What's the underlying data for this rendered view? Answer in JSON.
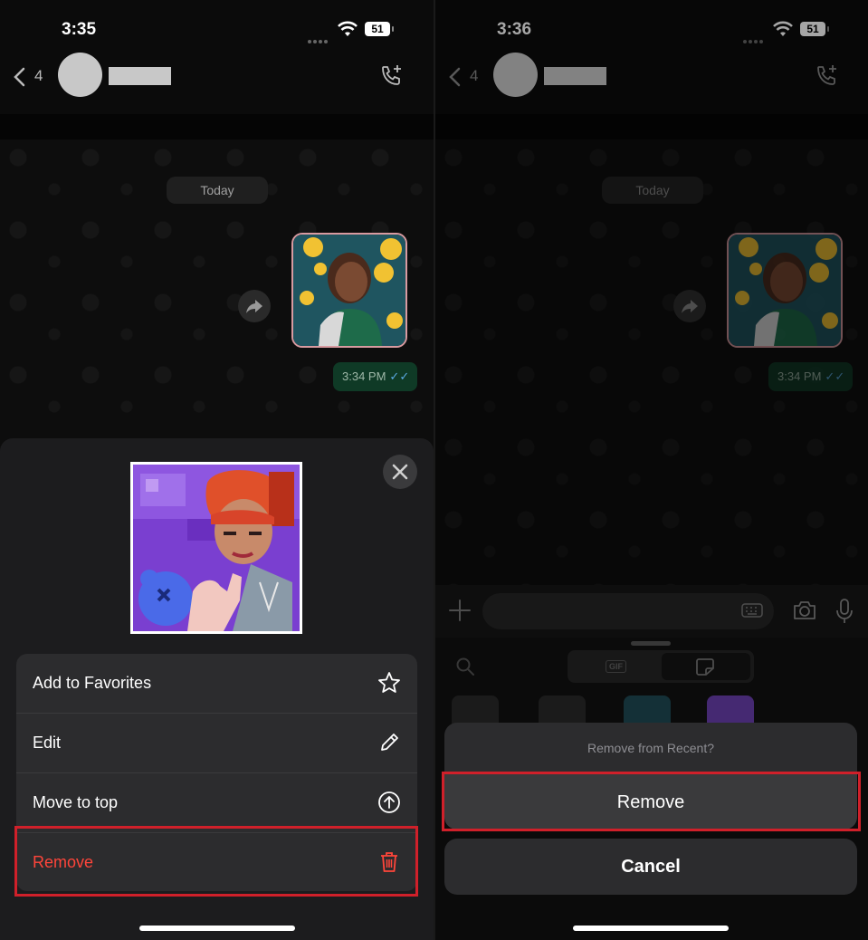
{
  "left": {
    "status": {
      "time": "3:35",
      "battery": "51"
    },
    "header": {
      "back_count": "4"
    },
    "chat": {
      "date_chip": "Today",
      "message_time": "3:34 PM",
      "ticks": "✓✓"
    },
    "menu": {
      "items": [
        {
          "label": "Add to Favorites",
          "icon": "star-icon"
        },
        {
          "label": "Edit",
          "icon": "pencil-icon"
        },
        {
          "label": "Move to top",
          "icon": "arrow-up-circle-icon"
        },
        {
          "label": "Remove",
          "icon": "trash-icon"
        }
      ]
    }
  },
  "right": {
    "status": {
      "time": "3:36",
      "battery": "51"
    },
    "header": {
      "back_count": "4"
    },
    "chat": {
      "date_chip": "Today",
      "message_time": "3:34 PM",
      "ticks": "✓✓"
    },
    "tray": {
      "gif_label": "GIF"
    },
    "action_sheet": {
      "title": "Remove from Recent?",
      "remove_label": "Remove",
      "cancel_label": "Cancel"
    }
  },
  "colors": {
    "danger": "#ff453a",
    "highlight": "#d0202a",
    "sent_bubble": "#0f3a26"
  }
}
